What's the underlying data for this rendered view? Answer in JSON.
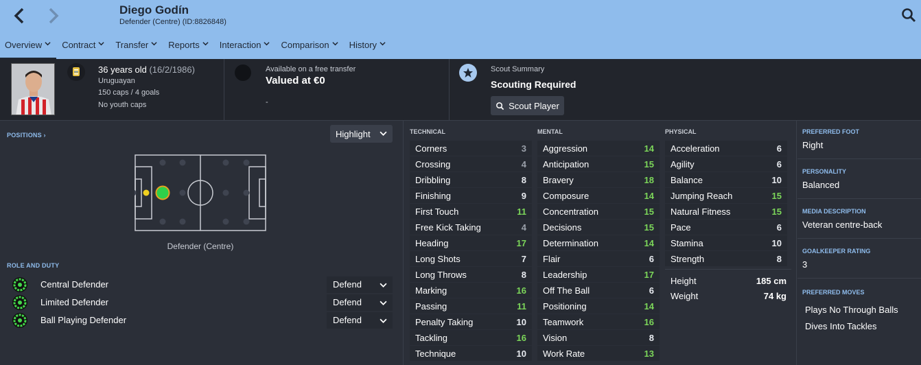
{
  "header": {
    "name": "Diego Godín",
    "subtitle": "Defender (Centre) (ID:8826848)"
  },
  "menu": [
    {
      "label": "Overview"
    },
    {
      "label": "Contract"
    },
    {
      "label": "Transfer"
    },
    {
      "label": "Reports"
    },
    {
      "label": "Interaction"
    },
    {
      "label": "Comparison"
    },
    {
      "label": "History"
    }
  ],
  "bio": {
    "age": "36 years old",
    "dob": "(16/2/1986)",
    "nationality": "Uruguayan",
    "caps": "150 caps / 4 goals",
    "youth": "No youth caps"
  },
  "transfer": {
    "status": "Available on a free transfer",
    "value": "Valued at €0",
    "extra": "-"
  },
  "scout": {
    "label": "Scout Summary",
    "status": "Scouting Required",
    "button": "Scout Player"
  },
  "positions": {
    "title": "POSITIONS",
    "highlight": "Highlight",
    "caption": "Defender (Centre)"
  },
  "roles": {
    "title": "ROLE AND DUTY",
    "items": [
      {
        "name": "Central Defender",
        "duty": "Defend"
      },
      {
        "name": "Limited Defender",
        "duty": "Defend"
      },
      {
        "name": "Ball Playing Defender",
        "duty": "Defend"
      }
    ]
  },
  "attributes": {
    "technical": {
      "title": "TECHNICAL",
      "items": [
        {
          "n": "Corners",
          "v": "3"
        },
        {
          "n": "Crossing",
          "v": "4"
        },
        {
          "n": "Dribbling",
          "v": "8"
        },
        {
          "n": "Finishing",
          "v": "9"
        },
        {
          "n": "First Touch",
          "v": "11"
        },
        {
          "n": "Free Kick Taking",
          "v": "4"
        },
        {
          "n": "Heading",
          "v": "17"
        },
        {
          "n": "Long Shots",
          "v": "7"
        },
        {
          "n": "Long Throws",
          "v": "8"
        },
        {
          "n": "Marking",
          "v": "16"
        },
        {
          "n": "Passing",
          "v": "11"
        },
        {
          "n": "Penalty Taking",
          "v": "10"
        },
        {
          "n": "Tackling",
          "v": "16"
        },
        {
          "n": "Technique",
          "v": "10"
        }
      ]
    },
    "mental": {
      "title": "MENTAL",
      "items": [
        {
          "n": "Aggression",
          "v": "14"
        },
        {
          "n": "Anticipation",
          "v": "15"
        },
        {
          "n": "Bravery",
          "v": "18"
        },
        {
          "n": "Composure",
          "v": "14"
        },
        {
          "n": "Concentration",
          "v": "15"
        },
        {
          "n": "Decisions",
          "v": "15"
        },
        {
          "n": "Determination",
          "v": "14"
        },
        {
          "n": "Flair",
          "v": "6"
        },
        {
          "n": "Leadership",
          "v": "17"
        },
        {
          "n": "Off The Ball",
          "v": "6"
        },
        {
          "n": "Positioning",
          "v": "14"
        },
        {
          "n": "Teamwork",
          "v": "16"
        },
        {
          "n": "Vision",
          "v": "8"
        },
        {
          "n": "Work Rate",
          "v": "13"
        }
      ]
    },
    "physical": {
      "title": "PHYSICAL",
      "items": [
        {
          "n": "Acceleration",
          "v": "6"
        },
        {
          "n": "Agility",
          "v": "6"
        },
        {
          "n": "Balance",
          "v": "10"
        },
        {
          "n": "Jumping Reach",
          "v": "15"
        },
        {
          "n": "Natural Fitness",
          "v": "15"
        },
        {
          "n": "Pace",
          "v": "6"
        },
        {
          "n": "Stamina",
          "v": "10"
        },
        {
          "n": "Strength",
          "v": "8"
        }
      ]
    }
  },
  "physique": {
    "height_label": "Height",
    "height": "185 cm",
    "weight_label": "Weight",
    "weight": "74 kg"
  },
  "details": {
    "foot_label": "PREFERRED FOOT",
    "foot": "Right",
    "personality_label": "PERSONALITY",
    "personality": "Balanced",
    "media_label": "MEDIA DESCRIPTION",
    "media": "Veteran centre-back",
    "gk_label": "GOALKEEPER RATING",
    "gk": "3",
    "moves_label": "PREFERRED MOVES",
    "moves": [
      "Plays No Through Balls",
      "Dives Into Tackles"
    ]
  },
  "colors": {
    "header": "#8fbcec",
    "high": "#7cd65a",
    "mid": "#e8ebf0",
    "low": "#9aa0aa",
    "accent": "#8fbcec"
  }
}
